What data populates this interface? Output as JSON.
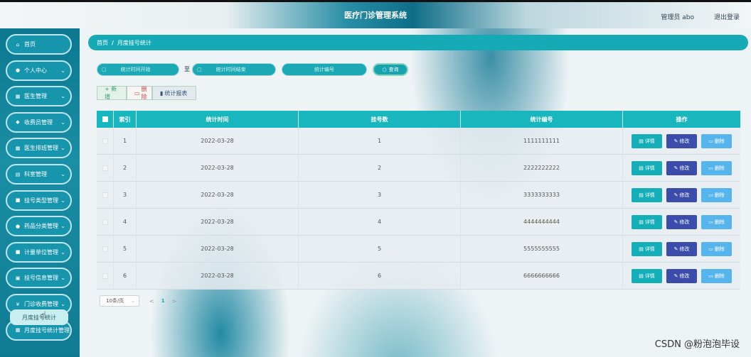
{
  "header": {
    "title": "医疗门诊管理系统",
    "admin": "管理员 abo",
    "logout": "退出登录"
  },
  "sidebar": {
    "items": [
      {
        "label": "首页",
        "icon": "home-icon",
        "glyph": "⌂",
        "chevron": false
      },
      {
        "label": "个人中心",
        "icon": "person-icon",
        "glyph": "●",
        "chevron": true
      },
      {
        "label": "医生管理",
        "icon": "grid-icon",
        "glyph": "▦",
        "chevron": true
      },
      {
        "label": "收费员管理",
        "icon": "thumbs-up-icon",
        "glyph": "◆",
        "chevron": true
      },
      {
        "label": "医生排班管理",
        "icon": "grid-icon",
        "glyph": "▦",
        "chevron": true
      },
      {
        "label": "科室管理",
        "icon": "hospital-icon",
        "glyph": "▤",
        "chevron": true
      },
      {
        "label": "挂号类型管理",
        "icon": "document-icon",
        "glyph": "■",
        "chevron": true
      },
      {
        "label": "药品分类管理",
        "icon": "location-icon",
        "glyph": "●",
        "chevron": true
      },
      {
        "label": "计量单位管理",
        "icon": "document-icon",
        "glyph": "■",
        "chevron": true
      },
      {
        "label": "挂号信息管理",
        "icon": "list-icon",
        "glyph": "▣",
        "chevron": true
      },
      {
        "label": "门诊收费管理",
        "icon": "money-icon",
        "glyph": "¥",
        "chevron": true
      },
      {
        "label": "月度挂号统计管理",
        "icon": "grid-icon",
        "glyph": "▦",
        "chevron": false
      }
    ],
    "sub_item": "月度挂号统计"
  },
  "breadcrumb": {
    "home": "首页",
    "separator": "/",
    "current": "月度挂号统计"
  },
  "search": {
    "start_placeholder": "统计时间开始",
    "to_label": "至",
    "end_placeholder": "统计时间结束",
    "code_placeholder": "统计编号",
    "search_button": "查询"
  },
  "actions": {
    "add": "+ 新增",
    "delete": "删除",
    "report": "统计报表"
  },
  "table": {
    "headers": {
      "index": "索引",
      "time": "统计时间",
      "count": "挂号数",
      "code": "统计编号",
      "ops": "操作"
    },
    "rows": [
      {
        "index": "1",
        "time": "2022-03-28",
        "count": "1",
        "code": "1111111111"
      },
      {
        "index": "2",
        "time": "2022-03-28",
        "count": "2",
        "code": "2222222222"
      },
      {
        "index": "3",
        "time": "2022-03-28",
        "count": "3",
        "code": "3333333333"
      },
      {
        "index": "4",
        "time": "2022-03-28",
        "count": "4",
        "code": "4444444444"
      },
      {
        "index": "5",
        "time": "2022-03-28",
        "count": "5",
        "code": "5555555555"
      },
      {
        "index": "6",
        "time": "2022-03-28",
        "count": "6",
        "code": "6666666666"
      }
    ],
    "op_labels": {
      "detail": "详情",
      "edit": "修改",
      "delete": "删除"
    }
  },
  "pagination": {
    "page_size": "10条/页",
    "prev": "<",
    "current": "1",
    "next": ">"
  },
  "watermark": "CSDN @粉泡泡毕设"
}
